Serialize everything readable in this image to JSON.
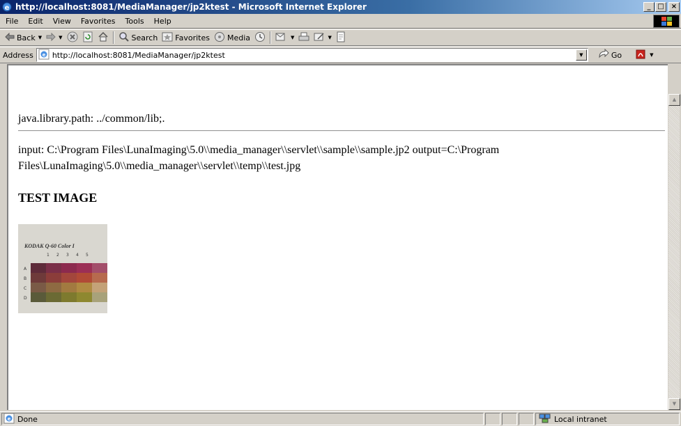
{
  "window": {
    "title": "http://localhost:8081/MediaManager/jp2ktest - Microsoft Internet Explorer",
    "minimize": "_",
    "maximize": "□",
    "close": "×"
  },
  "menu": [
    "File",
    "Edit",
    "View",
    "Favorites",
    "Tools",
    "Help"
  ],
  "toolbar": {
    "back": "Back",
    "search": "Search",
    "favorites": "Favorites",
    "media": "Media"
  },
  "address": {
    "label": "Address",
    "url": "http://localhost:8081/MediaManager/jp2ktest",
    "go": "Go"
  },
  "page": {
    "libpath": "java.library.path: ../common/lib;.",
    "io_line": "input: C:\\Program Files\\LunaImaging\\5.0\\\\media_manager\\\\servlet\\\\sample\\\\sample.jp2 output=C:\\Program Files\\LunaImaging\\5.0\\\\media_manager\\\\servlet\\\\temp\\\\test.jpg",
    "heading": "TEST IMAGE",
    "image": {
      "caption": "KODAK Q-60 Color I",
      "cols": [
        "1",
        "2",
        "3",
        "4",
        "5"
      ],
      "rows": [
        "A",
        "B",
        "C",
        "D"
      ],
      "swatches": [
        [
          "#5e2b3a",
          "#7a2f48",
          "#8c2a4e",
          "#9b2f55",
          "#a34e6a"
        ],
        [
          "#6e3a3a",
          "#8b3d3a",
          "#a3463c",
          "#b14a36",
          "#b76a4e"
        ],
        [
          "#7a5a46",
          "#8e6a42",
          "#a27a40",
          "#b08a42",
          "#c4a278"
        ],
        [
          "#5a5a3a",
          "#6b6a34",
          "#7e7a2e",
          "#8e8830",
          "#a8a27a"
        ]
      ]
    }
  },
  "status": {
    "text": "Done",
    "zone": "Local intranet"
  }
}
